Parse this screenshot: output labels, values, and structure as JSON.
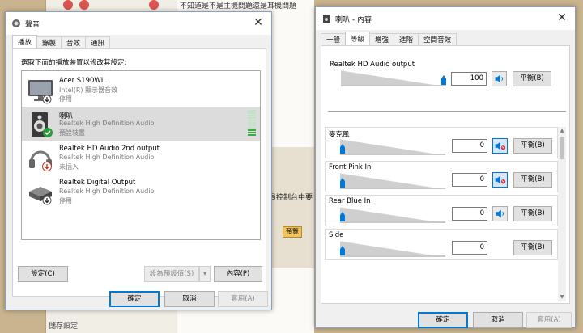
{
  "background": {
    "top_text": "不知道是不是主機問題還是耳機問題",
    "side_text": "員控制台中要",
    "preview_button": "預覽",
    "bottom_text": "儲存設定"
  },
  "sound_window": {
    "title": "聲音",
    "tabs": [
      "播放",
      "錄製",
      "音效",
      "通訊"
    ],
    "active_tab": 0,
    "instruction": "選取下面的播放裝置以修改其設定:",
    "devices": [
      {
        "name": "Acer S190WL",
        "sub": "Intel(R) 顯示器音效",
        "status": "停用",
        "icon": "monitor-icon",
        "badge": "disabled-arrow",
        "selected": false
      },
      {
        "name": "喇叭",
        "sub": "Realtek High Definition Audio",
        "status": "預設裝置",
        "icon": "speaker-icon",
        "badge": "default-check",
        "selected": true
      },
      {
        "name": "Realtek HD Audio 2nd output",
        "sub": "Realtek High Definition Audio",
        "status": "未插入",
        "icon": "headphones-icon",
        "badge": "unplugged-arrow",
        "selected": false
      },
      {
        "name": "Realtek Digital Output",
        "sub": "Realtek High Definition Audio",
        "status": "停用",
        "icon": "digital-output-icon",
        "badge": "disabled-arrow",
        "selected": false
      }
    ],
    "level": 0.3,
    "configure_button": "設定(C)",
    "set_default_button": "設為預設值(S)",
    "properties_button": "內容(P)",
    "ok_button": "確定",
    "cancel_button": "取消",
    "apply_button": "套用(A)"
  },
  "props_window": {
    "title": "喇叭 - 內容",
    "tabs": [
      "一般",
      "等級",
      "增強",
      "進階",
      "空間音效"
    ],
    "active_tab": 1,
    "output_label": "Realtek HD Audio output",
    "output_value": "100",
    "output_level": 1.0,
    "balance_button": "平衡(B)",
    "channels": [
      {
        "label": "麥克風",
        "value": "0",
        "level": 0,
        "muted": true,
        "has_mute": true
      },
      {
        "label": "Front Pink In",
        "value": "0",
        "level": 0,
        "muted": true,
        "has_mute": true
      },
      {
        "label": "Rear Blue In",
        "value": "0",
        "level": 0,
        "muted": false,
        "has_mute": true
      },
      {
        "label": "Side",
        "value": "0",
        "level": 0,
        "muted": false,
        "has_mute": false
      }
    ],
    "ok_button": "確定",
    "cancel_button": "取消",
    "apply_button": "套用(A)"
  }
}
